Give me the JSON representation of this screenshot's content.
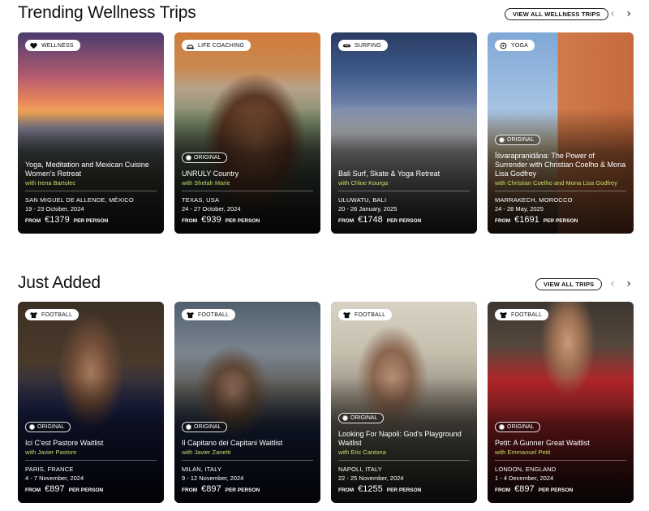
{
  "trending": {
    "title": "Trending Wellness Trips",
    "view_all": "VIEW ALL WELLNESS TRIPS",
    "cards": [
      {
        "category": "WELLNESS",
        "original": "",
        "title": "Yoga, Meditation and Mexican Cuisine Women's Retreat",
        "host": "with Irena Bartolec",
        "location": "SAN MIGUEL DE ALLENDE, MÉXICO",
        "dates": "19 - 23 October, 2024",
        "from": "FROM",
        "price": "€1379",
        "per": "PER PERSON"
      },
      {
        "category": "LIFE COACHING",
        "original": "ORIGINAL",
        "title": "UNRULY Country",
        "host": "with Shelah Marie",
        "location": "TEXAS, USA",
        "dates": "24 - 27 October, 2024",
        "from": "FROM",
        "price": "€939",
        "per": "PER PERSON"
      },
      {
        "category": "SURFING",
        "original": "",
        "title": "Bali Surf, Skate & Yoga Retreat",
        "host": "with Chloe Kourga",
        "location": "ULUWATU, BALI",
        "dates": "20 - 26 January, 2025",
        "from": "FROM",
        "price": "€1748",
        "per": "PER PERSON"
      },
      {
        "category": "YOGA",
        "original": "ORIGINAL",
        "title": "Īśvarapraṇidāna: The Power of Surrender with Christian Coelho & Mona Lisa Godfrey",
        "host": "with Christian Coelho and Mona Lisa Godfrey",
        "location": "MARRAKECH, MOROCCO",
        "dates": "24 - 28 May, 2025",
        "from": "FROM",
        "price": "€1691",
        "per": "PER PERSON"
      }
    ]
  },
  "added": {
    "title": "Just Added",
    "view_all": "VIEW ALL TRIPS",
    "cards": [
      {
        "category": "FOOTBALL",
        "original": "ORIGINAL",
        "title": "Ici C'est Pastore Waitlist",
        "host": "with Javier Pastore",
        "location": "PARIS, FRANCE",
        "dates": "4 - 7 November, 2024",
        "from": "FROM",
        "price": "€897",
        "per": "PER PERSON"
      },
      {
        "category": "FOOTBALL",
        "original": "ORIGINAL",
        "title": "Il Capitano dei Capitani Waitlist",
        "host": "with Javier Zanetti",
        "location": "MILAN, ITALY",
        "dates": "9 - 12 November, 2024",
        "from": "FROM",
        "price": "€897",
        "per": "PER PERSON"
      },
      {
        "category": "FOOTBALL",
        "original": "ORIGINAL",
        "title": "Looking For Napoli: God's Playground Waitlist",
        "host": "with Eric Cantona",
        "location": "NAPOLI, ITALY",
        "dates": "22 - 25 November, 2024",
        "from": "FROM",
        "price": "€1255",
        "per": "PER PERSON"
      },
      {
        "category": "FOOTBALL",
        "original": "ORIGINAL",
        "title": "Petit: A Gunner Great Waitlist",
        "host": "with Emmanuel Petit",
        "location": "LONDON, ENGLAND",
        "dates": "1 - 4 December, 2024",
        "from": "FROM",
        "price": "€897",
        "per": "PER PERSON"
      }
    ]
  },
  "icons": {
    "prev": "chevron-left-icon",
    "next": "chevron-right-icon"
  },
  "colors": {
    "host_text": "#c9dd6a",
    "card_shade": "#000000"
  }
}
